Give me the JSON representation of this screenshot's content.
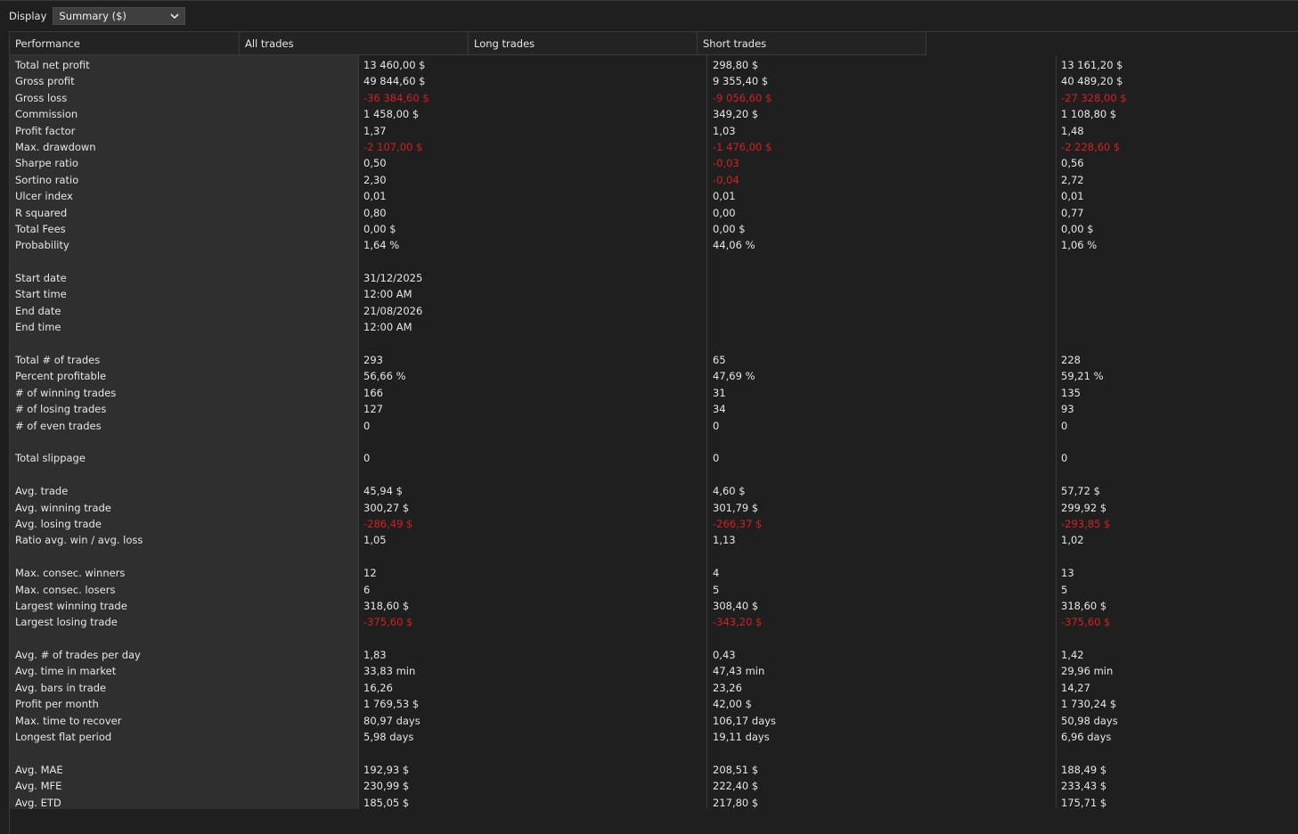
{
  "toolbar": {
    "display_label": "Display",
    "display_value": "Summary ($)",
    "dropdown_icon": "chevron-down-icon"
  },
  "colors": {
    "background": "#1f1f1f",
    "label_column": "#2f2f2f",
    "negative": "#d42020",
    "text": "#e6e6e6"
  },
  "headers": [
    "Performance",
    "All trades",
    "Long trades",
    "Short trades"
  ],
  "rows": [
    {
      "label": "Total net profit",
      "values": [
        "13 460,00 $",
        "298,80 $",
        "13 161,20 $"
      ],
      "neg": [
        false,
        false,
        false
      ]
    },
    {
      "label": "Gross profit",
      "values": [
        "49 844,60 $",
        "9 355,40 $",
        "40 489,20 $"
      ],
      "neg": [
        false,
        false,
        false
      ]
    },
    {
      "label": "Gross loss",
      "values": [
        "-36 384,60 $",
        "-9 056,60 $",
        "-27 328,00 $"
      ],
      "neg": [
        true,
        true,
        true
      ]
    },
    {
      "label": "Commission",
      "values": [
        "1 458,00 $",
        "349,20 $",
        "1 108,80 $"
      ],
      "neg": [
        false,
        false,
        false
      ]
    },
    {
      "label": "Profit factor",
      "values": [
        "1,37",
        "1,03",
        "1,48"
      ],
      "neg": [
        false,
        false,
        false
      ]
    },
    {
      "label": "Max. drawdown",
      "values": [
        "-2 107,00 $",
        "-1 476,00 $",
        "-2 228,60 $"
      ],
      "neg": [
        true,
        true,
        true
      ]
    },
    {
      "label": "Sharpe ratio",
      "values": [
        "0,50",
        "-0,03",
        "0,56"
      ],
      "neg": [
        false,
        true,
        false
      ]
    },
    {
      "label": "Sortino ratio",
      "values": [
        "2,30",
        "-0,04",
        "2,72"
      ],
      "neg": [
        false,
        true,
        false
      ]
    },
    {
      "label": "Ulcer index",
      "values": [
        "0,01",
        "0,01",
        "0,01"
      ],
      "neg": [
        false,
        false,
        false
      ]
    },
    {
      "label": "R squared",
      "values": [
        "0,80",
        "0,00",
        "0,77"
      ],
      "neg": [
        false,
        false,
        false
      ]
    },
    {
      "label": "Total Fees",
      "values": [
        "0,00 $",
        "0,00 $",
        "0,00 $"
      ],
      "neg": [
        false,
        false,
        false
      ]
    },
    {
      "label": "Probability",
      "values": [
        "1,64 %",
        "44,06 %",
        "1,06 %"
      ],
      "neg": [
        false,
        false,
        false
      ]
    },
    {
      "blank": true
    },
    {
      "label": "Start date",
      "values": [
        "31/12/2025",
        "",
        ""
      ],
      "neg": [
        false,
        false,
        false
      ]
    },
    {
      "label": "Start time",
      "values": [
        "12:00 AM",
        "",
        ""
      ],
      "neg": [
        false,
        false,
        false
      ]
    },
    {
      "label": "End date",
      "values": [
        "21/08/2026",
        "",
        ""
      ],
      "neg": [
        false,
        false,
        false
      ]
    },
    {
      "label": "End time",
      "values": [
        "12:00 AM",
        "",
        ""
      ],
      "neg": [
        false,
        false,
        false
      ]
    },
    {
      "blank": true
    },
    {
      "label": "Total # of trades",
      "values": [
        "293",
        "65",
        "228"
      ],
      "neg": [
        false,
        false,
        false
      ]
    },
    {
      "label": "Percent profitable",
      "values": [
        "56,66 %",
        "47,69 %",
        "59,21 %"
      ],
      "neg": [
        false,
        false,
        false
      ]
    },
    {
      "label": "# of winning trades",
      "values": [
        "166",
        "31",
        "135"
      ],
      "neg": [
        false,
        false,
        false
      ]
    },
    {
      "label": "# of losing trades",
      "values": [
        "127",
        "34",
        "93"
      ],
      "neg": [
        false,
        false,
        false
      ]
    },
    {
      "label": "# of even trades",
      "values": [
        "0",
        "0",
        "0"
      ],
      "neg": [
        false,
        false,
        false
      ]
    },
    {
      "blank": true
    },
    {
      "label": "Total slippage",
      "values": [
        "0",
        "0",
        "0"
      ],
      "neg": [
        false,
        false,
        false
      ]
    },
    {
      "blank": true
    },
    {
      "label": "Avg. trade",
      "values": [
        "45,94 $",
        "4,60 $",
        "57,72 $"
      ],
      "neg": [
        false,
        false,
        false
      ]
    },
    {
      "label": "Avg. winning trade",
      "values": [
        "300,27 $",
        "301,79 $",
        "299,92 $"
      ],
      "neg": [
        false,
        false,
        false
      ]
    },
    {
      "label": "Avg. losing trade",
      "values": [
        "-286,49 $",
        "-266,37 $",
        "-293,85 $"
      ],
      "neg": [
        true,
        true,
        true
      ]
    },
    {
      "label": "Ratio avg. win / avg. loss",
      "values": [
        "1,05",
        "1,13",
        "1,02"
      ],
      "neg": [
        false,
        false,
        false
      ]
    },
    {
      "blank": true
    },
    {
      "label": "Max. consec. winners",
      "values": [
        "12",
        "4",
        "13"
      ],
      "neg": [
        false,
        false,
        false
      ]
    },
    {
      "label": "Max. consec. losers",
      "values": [
        "6",
        "5",
        "5"
      ],
      "neg": [
        false,
        false,
        false
      ]
    },
    {
      "label": "Largest winning trade",
      "values": [
        "318,60 $",
        "308,40 $",
        "318,60 $"
      ],
      "neg": [
        false,
        false,
        false
      ]
    },
    {
      "label": "Largest losing trade",
      "values": [
        "-375,60 $",
        "-343,20 $",
        "-375,60 $"
      ],
      "neg": [
        true,
        true,
        true
      ]
    },
    {
      "blank": true
    },
    {
      "label": "Avg. # of trades per day",
      "values": [
        "1,83",
        "0,43",
        "1,42"
      ],
      "neg": [
        false,
        false,
        false
      ]
    },
    {
      "label": "Avg. time in market",
      "values": [
        "33,83 min",
        "47,43 min",
        "29,96 min"
      ],
      "neg": [
        false,
        false,
        false
      ]
    },
    {
      "label": "Avg. bars in trade",
      "values": [
        "16,26",
        "23,26",
        "14,27"
      ],
      "neg": [
        false,
        false,
        false
      ]
    },
    {
      "label": "Profit per month",
      "values": [
        "1 769,53 $",
        "42,00 $",
        "1 730,24 $"
      ],
      "neg": [
        false,
        false,
        false
      ]
    },
    {
      "label": "Max. time to recover",
      "values": [
        "80,97 days",
        "106,17 days",
        "50,98 days"
      ],
      "neg": [
        false,
        false,
        false
      ]
    },
    {
      "label": "Longest flat period",
      "values": [
        "5,98 days",
        "19,11 days",
        "6,96 days"
      ],
      "neg": [
        false,
        false,
        false
      ]
    },
    {
      "blank": true
    },
    {
      "label": "Avg. MAE",
      "values": [
        "192,93 $",
        "208,51 $",
        "188,49 $"
      ],
      "neg": [
        false,
        false,
        false
      ]
    },
    {
      "label": "Avg. MFE",
      "values": [
        "230,99 $",
        "222,40 $",
        "233,43 $"
      ],
      "neg": [
        false,
        false,
        false
      ]
    },
    {
      "label": "Avg. ETD",
      "values": [
        "185,05 $",
        "217,80 $",
        "175,71 $"
      ],
      "neg": [
        false,
        false,
        false
      ]
    }
  ]
}
